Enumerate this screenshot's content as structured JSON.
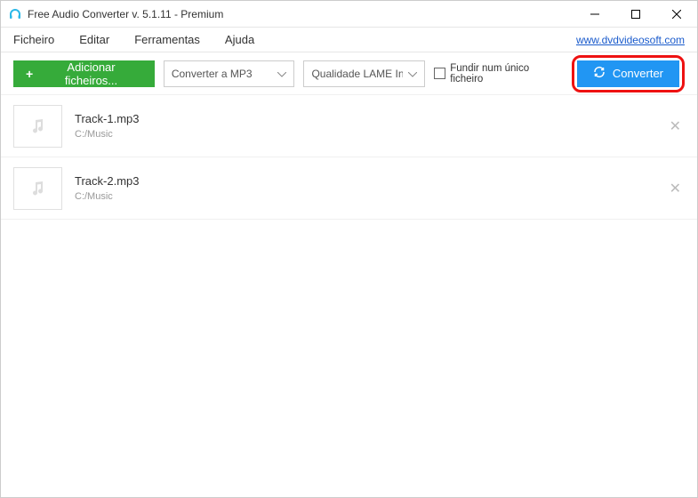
{
  "app_title": "Free Audio Converter v. 5.1.11 - Premium",
  "menubar": {
    "items": [
      "Ficheiro",
      "Editar",
      "Ferramentas",
      "Ajuda"
    ],
    "link": "www.dvdvideosoft.com"
  },
  "toolbar": {
    "add_label": "Adicionar ficheiros...",
    "format_label": "Converter a MP3",
    "quality_label": "Qualidade LAME Insane",
    "merge_label": "Fundir num único ficheiro",
    "convert_label": "Converter"
  },
  "files": [
    {
      "name": "Track-1.mp3",
      "path": "C:/Music"
    },
    {
      "name": "Track-2.mp3",
      "path": "C:/Music"
    }
  ]
}
